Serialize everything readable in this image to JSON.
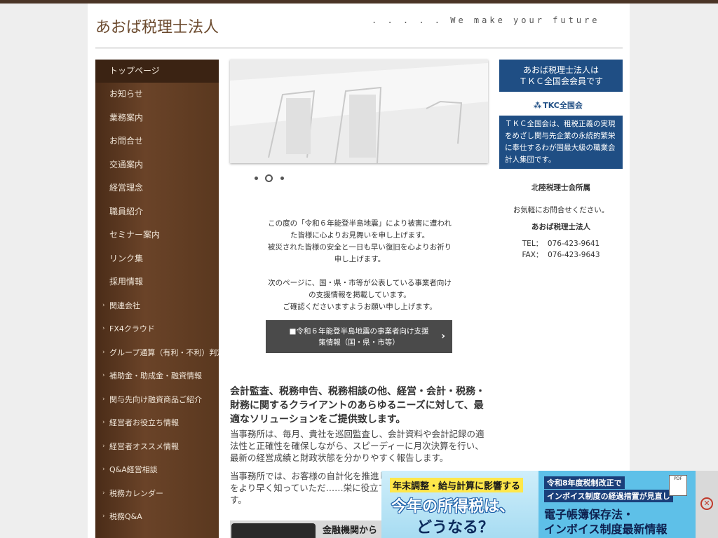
{
  "header": {
    "site_title": "あおば税理士法人",
    "tagline": ". . . . . We make your future"
  },
  "sidebar": {
    "items": [
      {
        "label": "トップページ",
        "active": true
      },
      {
        "label": "お知らせ"
      },
      {
        "label": "業務案内"
      },
      {
        "label": "お問合せ"
      },
      {
        "label": "交通案内"
      },
      {
        "label": "経営理念"
      },
      {
        "label": "職員紹介"
      },
      {
        "label": "セミナー案内"
      },
      {
        "label": "リンク集"
      },
      {
        "label": "採用情報"
      }
    ],
    "sub_items": [
      {
        "label": "関連会社"
      },
      {
        "label": "FX4クラウド"
      },
      {
        "label": "グループ通算（有利・不利）判定"
      },
      {
        "label": "補助金・助成金・融資情報"
      },
      {
        "label": "関与先向け融資商品ご紹介"
      },
      {
        "label": "経営者お役立ち情報"
      },
      {
        "label": "経営者オススメ情報"
      },
      {
        "label": "Q&A経営相談"
      },
      {
        "label": "税務カレンダー"
      },
      {
        "label": "税務Q&A"
      }
    ],
    "sub_arrow": "›"
  },
  "slideshow": {
    "dot_count": 3,
    "active_dot": 2
  },
  "notice": {
    "para1_line1": "この度の「令和６年能登半島地震」により被害に遭われた皆様に心よりお見舞いを申し上げます。",
    "para1_line2": "被災された皆様の安全と一日も早い復旧を心よりお祈り申し上げます。",
    "para2_line1": "次のページに、国・県・市等が公表している事業者向けの支援情報を掲載しています。",
    "para2_line2": "ご確認くださいますようお願い申し上げます。"
  },
  "support_button": {
    "label": "■令和６年能登半島地震の事業者向け支援策情報（国・県・市等）",
    "chevron": "›"
  },
  "intro": {
    "heading": "会計監査、税務申告、税務相談の他、経営・会計・税務・財務に関するクライアントのあらゆるニーズに対して、最適なソリューションをご提供致します。",
    "text1": "当事務所は、毎月、貴社を巡回監査し、会計資料や会計記録の適法性と正確性を確保しながら、スピーディーに月次決算を行い、最新の経営成績と財政状態を分かりやすく報告します。",
    "text2": "当事務所では、お客様の自計化を推進していま……り会社の状況をより早く知っていただ……栄に役立てていただきたいからです。"
  },
  "finance_banner": {
    "text": "金融機関から"
  },
  "right_column": {
    "tkc_box": "あおば税理士法人は\nＴＫＣ全国会会員です",
    "tkc_logo": "TKC全国会",
    "tkc_logo_mark": "⁂",
    "tkc_desc": "ＴＫＣ全国会は、租税正義の実現をめざし関与先企業の永続的繁栄に奉仕するわが国最大級の職業会計人集団です。",
    "affiliation": "北陸税理士会所属",
    "contact_lead": "お気軽にお問合せください。",
    "firm_name": "あおば税理士法人",
    "tel": "TEL：  076-423-9641",
    "fax": "FAX：  076-423-9643"
  },
  "ad": {
    "left_headline": "年末調整・給与計算に影響する",
    "left_big1": "今年の所得税は、",
    "left_big2": "どうなる？",
    "right_line1": "令和8年度税制改正で",
    "right_line2": "インボイス制度の経過措置が見直し",
    "right_big1": "電子帳簿保存法・",
    "right_big2": "インボイス制度最新情報",
    "doc_label": "PDF",
    "close_symbol": "✕"
  }
}
